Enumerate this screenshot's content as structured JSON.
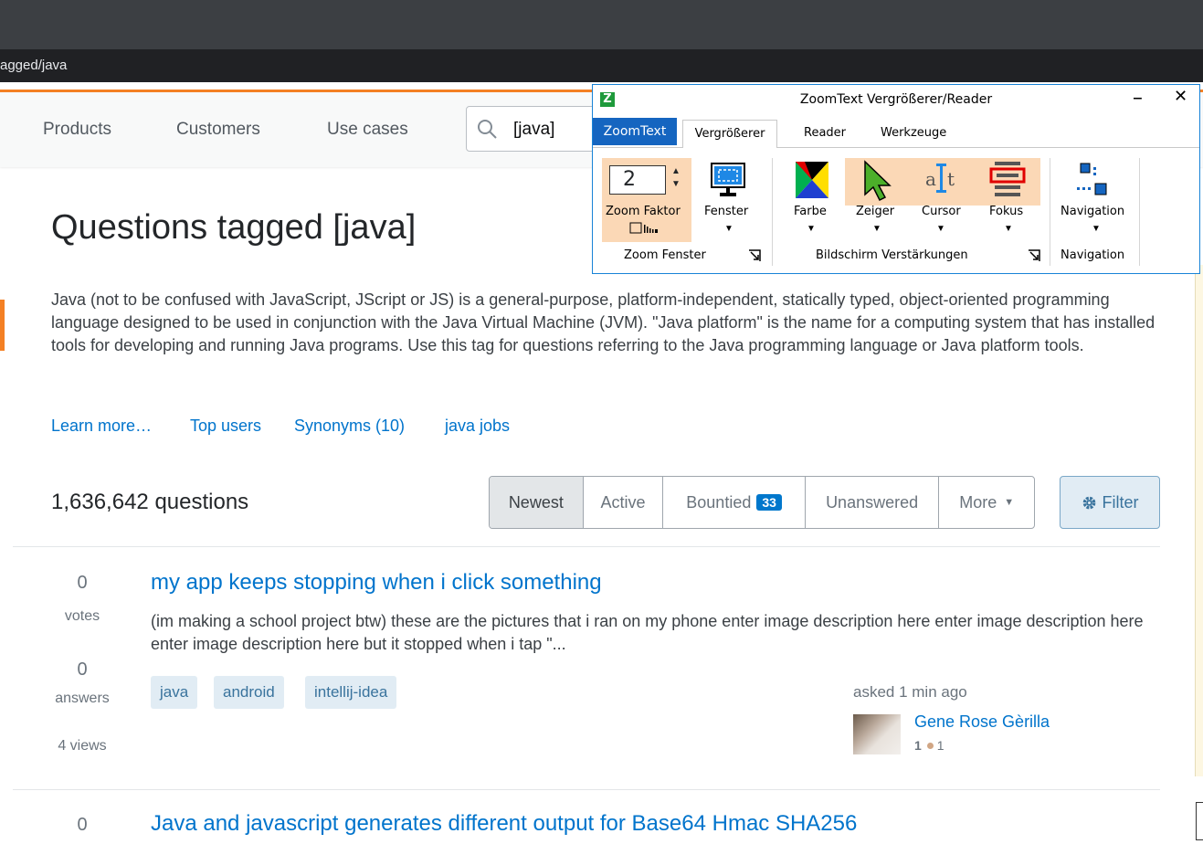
{
  "browser": {
    "url_fragment": "agged/java"
  },
  "topbar": {
    "nav": [
      "Products",
      "Customers",
      "Use cases"
    ],
    "search_value": "[java]"
  },
  "page": {
    "title": "Questions tagged [java]",
    "description": "Java (not to be confused with JavaScript, JScript or JS) is a general-purpose, platform-independent, statically typed, object-oriented programming language designed to be used in conjunction with the Java Virtual Machine (JVM). \"Java platform\" is the name for a computing system that has installed tools for developing and running Java programs. Use this tag for questions referring to the Java programming language or Java platform tools.",
    "links": [
      "Learn more…",
      "Top users",
      "Synonyms (10)",
      "java jobs"
    ],
    "question_count": "1,636,642 questions",
    "sort_tabs": {
      "newest": "Newest",
      "active": "Active",
      "bountied": "Bountied",
      "bountied_count": "33",
      "unanswered": "Unanswered",
      "more": "More"
    },
    "filter_label": "Filter"
  },
  "questions": [
    {
      "votes": "0",
      "votes_label": "votes",
      "answers": "0",
      "answers_label": "answers",
      "views": "4 views",
      "title": "my app keeps stopping when i click something",
      "excerpt": "(im making a school project btw) these are the pictures that i ran on my phone enter image description here enter image description here enter image description here but it stopped when i tap \"...",
      "tags": [
        "java",
        "android",
        "intellij-idea"
      ],
      "asked": "asked 1 min ago",
      "user": "Gene Rose Gèrilla",
      "reputation": "1",
      "bronze": "1"
    },
    {
      "votes": "0",
      "title": "Java and javascript generates different output for Base64 Hmac SHA256"
    }
  ],
  "zoomtext": {
    "logo": "Z",
    "title": "ZoomText Vergrößerer/Reader",
    "tabs": {
      "zoomtext": "ZoomText",
      "vergroesserer": "Vergrößerer",
      "reader": "Reader",
      "werkzeuge": "Werkzeuge"
    },
    "zoom_value": "2",
    "buttons": {
      "zoom_faktor": "Zoom Faktor",
      "fenster": "Fenster",
      "farbe": "Farbe",
      "zeiger": "Zeiger",
      "cursor": "Cursor",
      "fokus": "Fokus",
      "navigation": "Navigation"
    },
    "groups": {
      "zoom_fenster": "Zoom Fenster",
      "bildschirm": "Bildschirm Verstärkungen",
      "navigation": "Navigation"
    }
  },
  "colors": {
    "accent_orange": "#f48024",
    "link_blue": "#0074cc",
    "zoomtext_blue": "#1565c0",
    "highlight_peach": "#fbd8b6"
  }
}
